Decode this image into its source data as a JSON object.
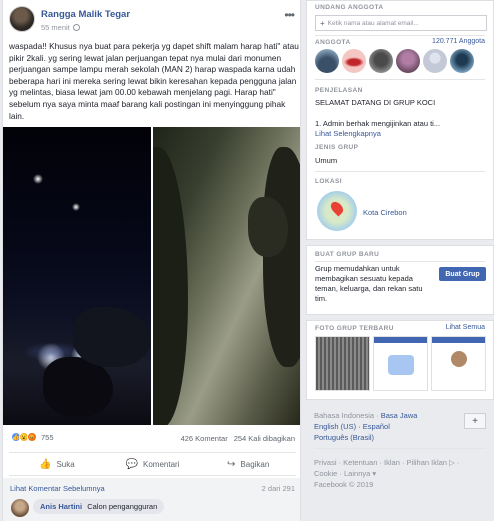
{
  "post": {
    "author": "Rangga Malik Tegar",
    "time": "55 menit",
    "text": "waspada!! Khusus nya buat para pekerja yg dapet shift malam harap hati\" atau pikir 2kali. yg sering lewat jalan perjuangan tepat nya mulai dari monumen perjuangan sampe lampu merah sekolah (MAN 2) harap waspada karna udah beberapa hari ini mereka sering lewat bikin keresahan kepada pengguna jalan yg melintas, biasa lewat jam 00.00 kebawah menjelang pagi. Harap hati\" sebelum nya saya minta maaf barang kali postingan ini menyinggung pihak lain.",
    "reaction_count": "755",
    "comments_count": "426 Komentar",
    "shares_count": "254 Kali dibagikan",
    "actions": {
      "like": "Suka",
      "comment": "Komentari",
      "share": "Bagikan"
    },
    "prev_comments_link": "Lihat Komentar Sebelumnya",
    "prev_comments_count": "2 dari 291",
    "comment": {
      "name": "Anis Hartini",
      "text": "Calon pengangguran"
    }
  },
  "sidebar": {
    "invite": {
      "title": "UNDANG ANGGOTA",
      "placeholder": "Ketik nama atau alamat email..."
    },
    "members": {
      "title": "ANGGOTA",
      "count": "120.771 Anggota"
    },
    "description": {
      "title": "PENJELASAN",
      "heading": "SELAMAT DATANG DI GRUP KOCI",
      "rule": "1. Admin berhak mengijinkan atau ti...",
      "more": "Lihat Selengkapnya"
    },
    "group_type": {
      "title": "JENIS GRUP",
      "value": "Umum"
    },
    "location": {
      "title": "LOKASI",
      "value": "Kota Cirebon"
    },
    "create_group": {
      "title": "BUAT GRUP BARU",
      "text": "Grup memudahkan untuk membagikan sesuatu kepada teman, keluarga, dan rekan satu tim.",
      "button": "Buat Grup"
    },
    "photos": {
      "title": "FOTO GRUP TERBARU",
      "see_all": "Lihat Semua"
    },
    "languages": {
      "primary": "Bahasa Indonesia",
      "sep1": " · ",
      "lang2": "Basa Jawa",
      "lang3": "English (US)",
      "lang4": "Español",
      "lang5": "Português (Brasil)"
    },
    "footer": {
      "line1": "Privasi · Ketentuan · Iklan · Pilihan Iklan ▷ ·",
      "line2": "Cookie · Lainnya ▾",
      "copyright": "Facebook © 2019"
    }
  }
}
